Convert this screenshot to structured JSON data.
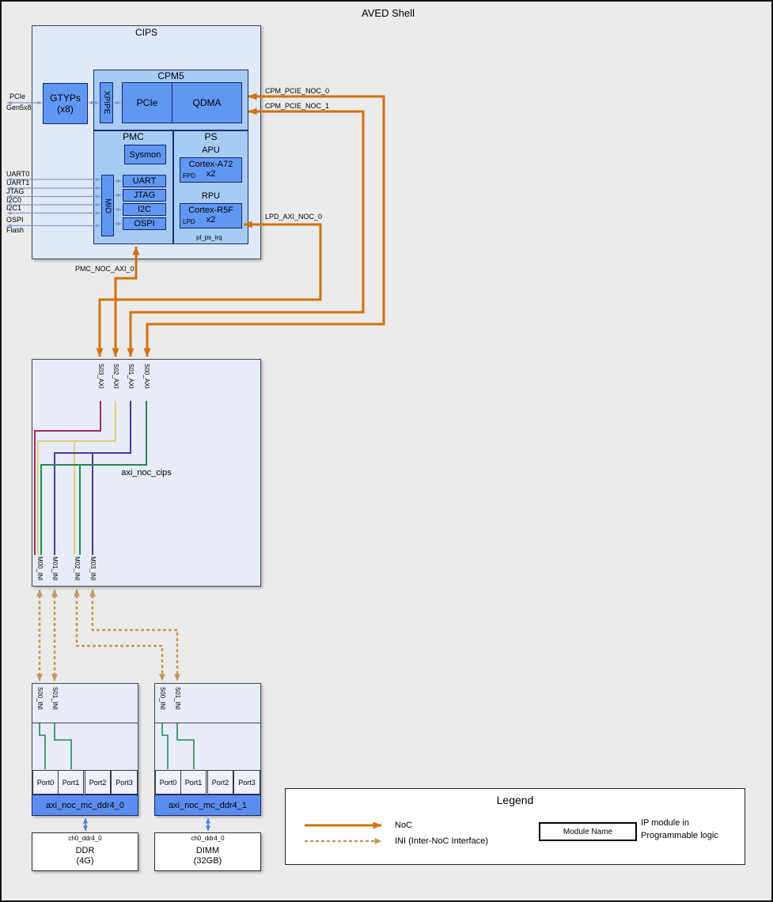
{
  "title": "AVED Shell",
  "colors": {
    "noc_orange": "#d2720b",
    "ini_tan": "#bf9b59",
    "net_crimson": "#9c2f60",
    "net_khaki": "#dfcd7d",
    "net_indigo": "#46399e",
    "net_green": "#1f8b4e",
    "link_blue": "#7f9ad0",
    "ddr_link_blue": "#4d7fd6",
    "module_blue": "#6097f2",
    "container_blue": "#a6ccf4",
    "canvas_gray": "#ebebeb"
  },
  "cips": {
    "label": "CIPS",
    "gtyp_line1": "GTYPs",
    "gtyp_line2": "(x8)",
    "cpm5": {
      "label": "CPM5",
      "xpipe": "XPIPE",
      "pcie": "PCIe",
      "qdma": "QDMA"
    },
    "pmc": {
      "label": "PMC",
      "sysmon": "Sysmon",
      "mio": "MIO",
      "peripherals": [
        "UART",
        "JTAG",
        "I2C",
        "OSPI"
      ]
    },
    "ps": {
      "label": "PS",
      "apu_label": "APU",
      "apu_core": "Cortex-A72",
      "apu_count": "x2",
      "apu_domain": "FPD",
      "rpu_label": "RPU",
      "rpu_core": "Cortex-R5F",
      "rpu_count": "x2",
      "rpu_domain": "LPD",
      "irq": "pl_ps_irq"
    }
  },
  "external": {
    "pcie_line1": "PCIe",
    "pcie_line2": "Gen5x8",
    "mio_labels": [
      "UART0",
      "UART1",
      "JTAG",
      "I2C0",
      "I2C1"
    ],
    "ospi": "OSPI",
    "flash": "Flash"
  },
  "noc": {
    "labels": [
      "CPM_PCIE_NOC_0",
      "CPM_PCIE_NOC_1",
      "LPD_AXI_NOC_0",
      "PMC_NOC_AXI_0"
    ]
  },
  "axi_noc_cips": {
    "label": "axi_noc_cips",
    "s_ports": [
      "S03_AXI",
      "S02_AXI",
      "S01_AXI",
      "S00_AXI"
    ],
    "m_ports": [
      "M00_INI",
      "M01_INI",
      "M02_INI",
      "M03_INI"
    ]
  },
  "mc0": {
    "label": "axi_noc_mc_ddr4_0",
    "s_ports": [
      "S00_INI",
      "S01_INI"
    ],
    "ports": [
      "Port0",
      "Port1",
      "Port2",
      "Port3"
    ]
  },
  "mc1": {
    "label": "axi_noc_mc_ddr4_1",
    "s_ports": [
      "S00_INI",
      "S01_INI"
    ],
    "ports": [
      "Port0",
      "Port1",
      "Port2",
      "Port3"
    ]
  },
  "ddr0": {
    "channel": "ch0_ddr4_0",
    "line1": "DDR",
    "line2": "(4G)"
  },
  "ddr1": {
    "channel": "ch0_ddr4_0",
    "line1": "DIMM",
    "line2": "(32GB)"
  },
  "legend": {
    "title": "Legend",
    "noc_label": "NoC",
    "ini_label": "INI (Inter-NoC Interface)",
    "module_box": "Module Name",
    "ip_line1": "IP module in",
    "ip_line2": "Programmable logic"
  }
}
